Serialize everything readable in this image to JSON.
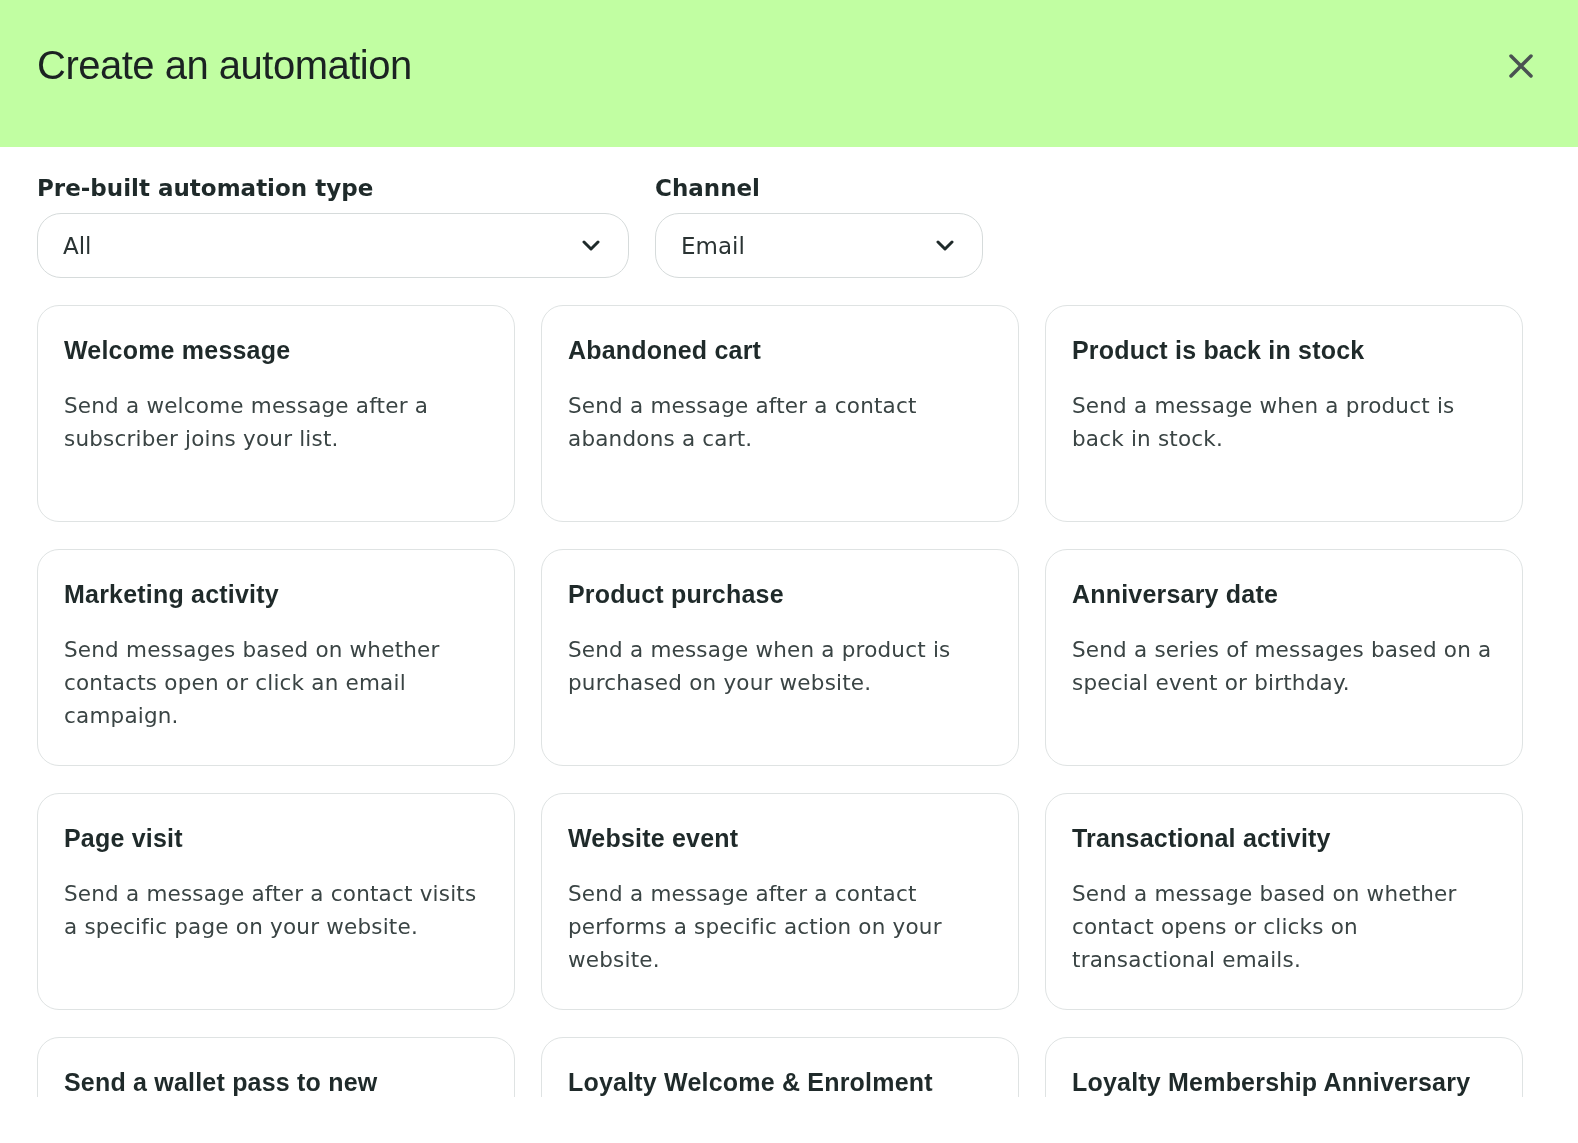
{
  "dialog": {
    "title": "Create an automation"
  },
  "filters": [
    {
      "label": "Pre-built automation type",
      "value": "All"
    },
    {
      "label": "Channel",
      "value": "Email"
    }
  ],
  "cards": [
    {
      "title": "Welcome message",
      "description": "Send a welcome message after a subscriber joins your list."
    },
    {
      "title": "Abandoned cart",
      "description": "Send a message after a contact abandons a cart."
    },
    {
      "title": "Product is back in stock",
      "description": "Send a message when a product is back in stock."
    },
    {
      "title": "Marketing activity",
      "description": "Send messages based on whether contacts open or click an email campaign."
    },
    {
      "title": "Product purchase",
      "description": "Send a message when a product is purchased on your website."
    },
    {
      "title": "Anniversary date",
      "description": "Send a series of messages based on a special event or birthday."
    },
    {
      "title": "Page visit",
      "description": "Send a message after a contact visits a specific page on your website."
    },
    {
      "title": "Website event",
      "description": "Send a message after a contact performs a specific action on your website."
    },
    {
      "title": "Transactional activity",
      "description": "Send a message based on whether contact opens or clicks on transactional emails."
    },
    {
      "title": "Send a wallet pass to new"
    },
    {
      "title": "Loyalty Welcome & Enrolment"
    },
    {
      "title": "Loyalty Membership Anniversary"
    }
  ]
}
